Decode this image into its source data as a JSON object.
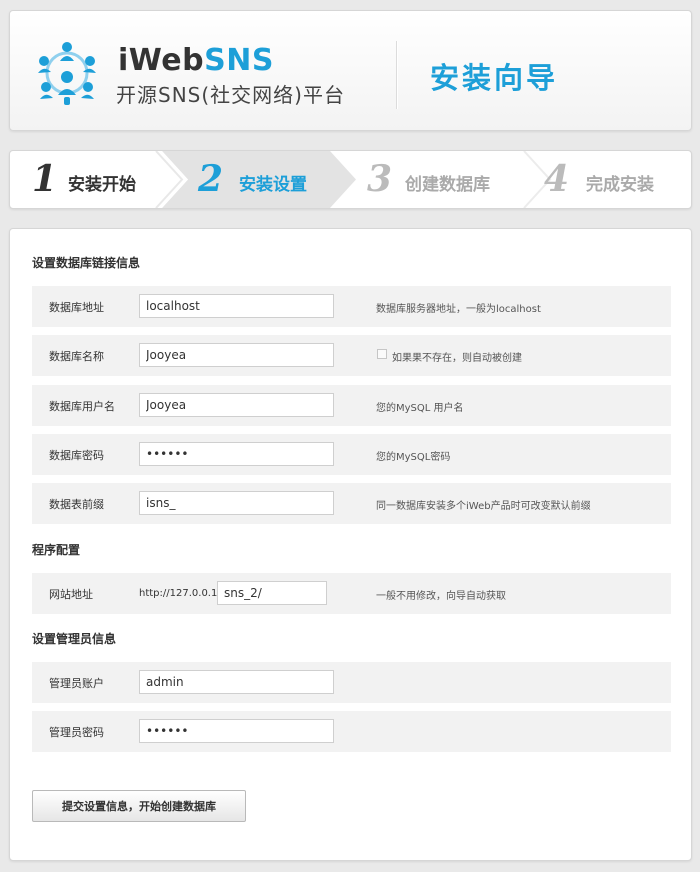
{
  "header": {
    "brand_main": "iWeb",
    "brand_accent": "SNS",
    "brand_subtitle": "开源SNS(社交网络)平台",
    "wizard_title": "安装向导"
  },
  "steps": [
    {
      "num": "1",
      "label": "安装开始",
      "state": "done"
    },
    {
      "num": "2",
      "label": "安装设置",
      "state": "active"
    },
    {
      "num": "3",
      "label": "创建数据库",
      "state": "pending"
    },
    {
      "num": "4",
      "label": "完成安装",
      "state": "pending"
    }
  ],
  "sections": {
    "db": "设置数据库链接信息",
    "program": "程序配置",
    "admin": "设置管理员信息"
  },
  "db_fields": {
    "host": {
      "label": "数据库地址",
      "value": "localhost",
      "hint": "数据库服务器地址，一般为localhost"
    },
    "name": {
      "label": "数据库名称",
      "value": "Jooyea",
      "hint": "如果果不存在，则自动被创建"
    },
    "user": {
      "label": "数据库用户名",
      "value": "Jooyea",
      "hint": "您的MySQL 用户名"
    },
    "password": {
      "label": "数据库密码",
      "value": "......",
      "hint": "您的MySQL密码"
    },
    "prefix": {
      "label": "数据表前缀",
      "value": "isns_",
      "hint": "同一数据库安装多个iWeb产品时可改变默认前缀"
    }
  },
  "site": {
    "label": "网站地址",
    "url_prefix": "http://127.0.0.1/",
    "value": "sns_2/",
    "hint": "一般不用修改，向导自动获取"
  },
  "admin_fields": {
    "account": {
      "label": "管理员账户",
      "value": "admin"
    },
    "password": {
      "label": "管理员密码",
      "value": "......"
    }
  },
  "submit_label": "提交设置信息，开始创建数据库",
  "colors": {
    "accent": "#1d9fd8",
    "inactive": "#aaaaaa",
    "row_bg": "#f2f2f2"
  }
}
